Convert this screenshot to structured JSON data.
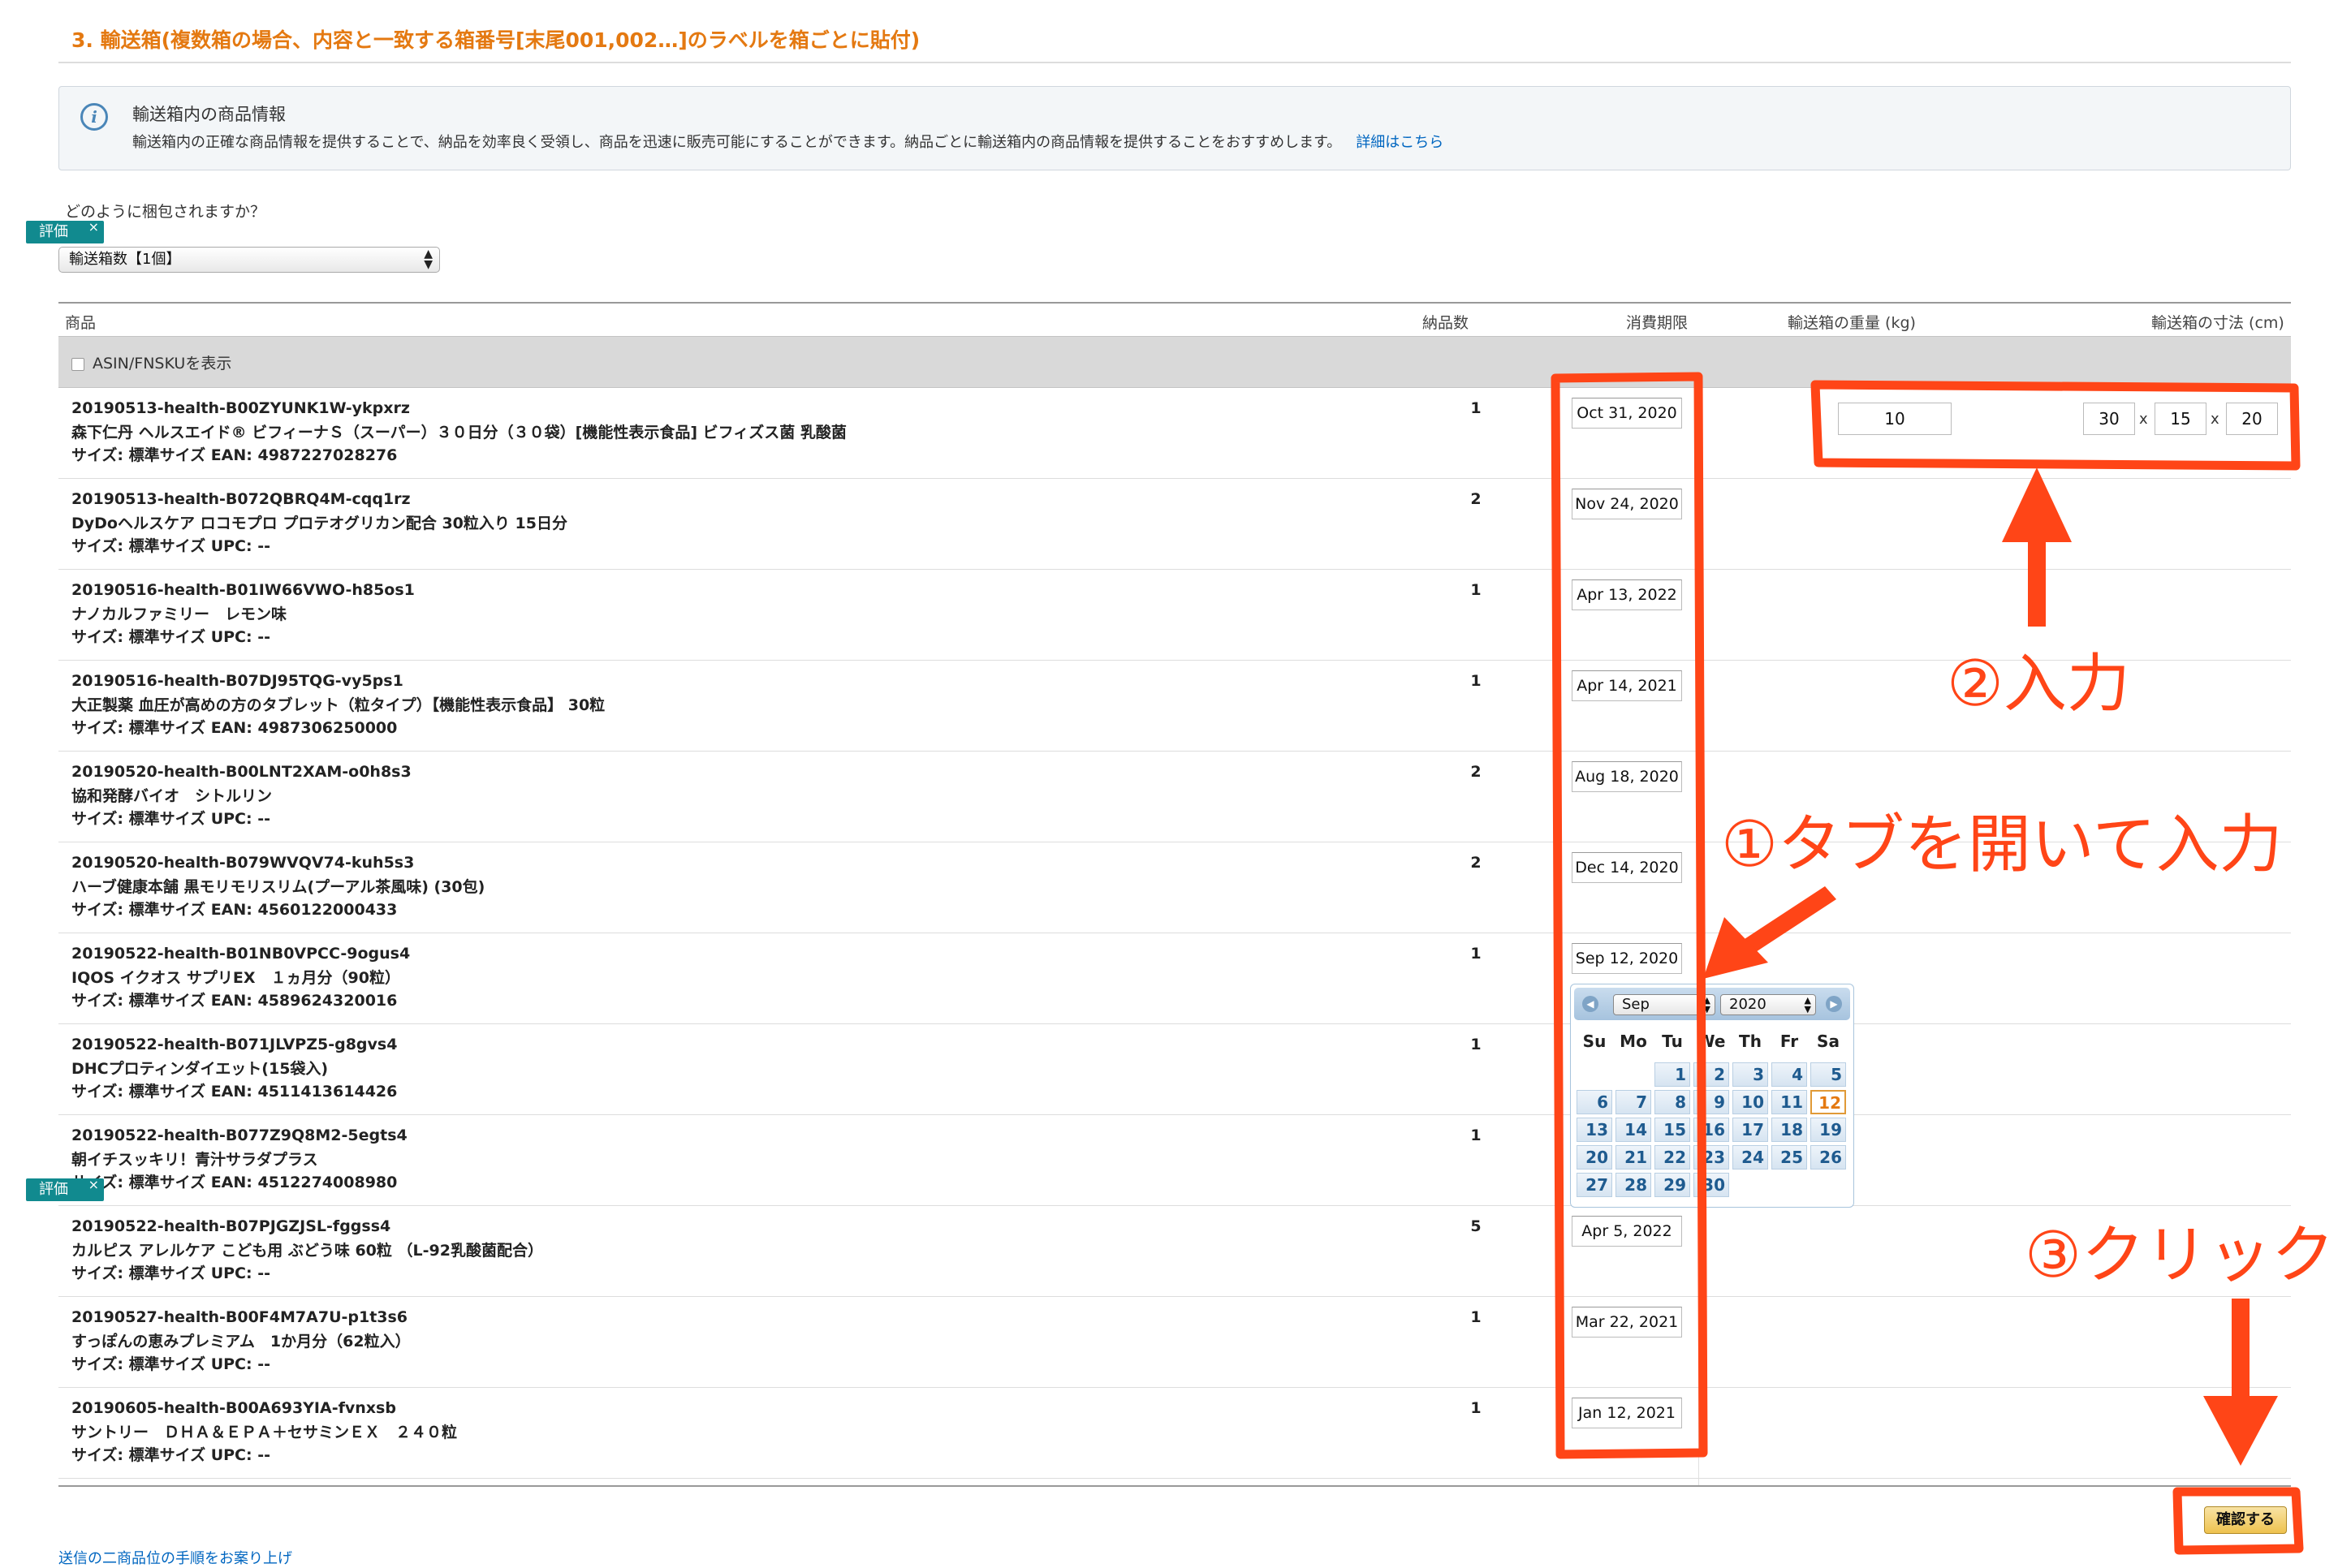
{
  "section": {
    "title": "3. 輸送箱(複数箱の場合、内容と一致する箱番号[末尾001,002…]のラベルを箱ごとに貼付)"
  },
  "info": {
    "icon": "info-icon",
    "title": "輸送箱内の商品情報",
    "body": "輸送箱内の正確な商品情報を提供することで、納品を効率良く受領し、商品を迅速に販売可能にすることができます。納品ごとに輸送箱内の商品情報を提供することをおすすめします。",
    "link": "詳細はこちら"
  },
  "packing": {
    "question": "どのように梱包されますか？",
    "eval_tag": "評価",
    "eval_close": "×",
    "selected": "輸送箱数【1個】"
  },
  "table": {
    "headers": {
      "product": "商品",
      "qty": "納品数",
      "expiry": "消費期限",
      "weight": "輸送箱の重量 (kg)",
      "dims": "輸送箱の寸法 (cm)"
    },
    "asin_label": "ASIN/FNSKUを表示",
    "rows": [
      {
        "sku": "20190513-health-B00ZYUNK1W-ykpxrz",
        "name": "森下仁丹 ヘルスエイド® ビフィーナＳ（スーパー）３０日分（３０袋）[機能性表示食品] ビフィズス菌 乳酸菌",
        "meta": "サイズ: 標準サイズ EAN: 4987227028276",
        "qty": "1",
        "date": "Oct 31, 2020"
      },
      {
        "sku": "20190513-health-B072QBRQ4M-cqq1rz",
        "name": "DyDoヘルスケア ロコモプロ プロテオグリカン配合 30粒入り 15日分",
        "meta": "サイズ: 標準サイズ UPC: --",
        "qty": "2",
        "date": "Nov 24, 2020"
      },
      {
        "sku": "20190516-health-B01IW66VWO-h85os1",
        "name": "ナノカルファミリー　レモン味",
        "meta": "サイズ: 標準サイズ UPC: --",
        "qty": "1",
        "date": "Apr 13, 2022"
      },
      {
        "sku": "20190516-health-B07DJ95TQG-vy5ps1",
        "name": "大正製薬 血圧が高めの方のタブレット（粒タイプ）【機能性表示食品】 30粒",
        "meta": "サイズ: 標準サイズ EAN: 4987306250000",
        "qty": "1",
        "date": "Apr 14, 2021"
      },
      {
        "sku": "20190520-health-B00LNT2XAM-o0h8s3",
        "name": "協和発酵バイオ　シトルリン",
        "meta": "サイズ: 標準サイズ UPC: --",
        "qty": "2",
        "date": "Aug 18, 2020"
      },
      {
        "sku": "20190520-health-B079WVQV74-kuh5s3",
        "name": "ハーブ健康本舗 黒モリモリスリム(プーアル茶風味) (30包)",
        "meta": "サイズ: 標準サイズ EAN: 4560122000433",
        "qty": "2",
        "date": "Dec 14, 2020"
      },
      {
        "sku": "20190522-health-B01NB0VPCC-9ogus4",
        "name": "IQOS イクオス サプリEX　１ヵ月分（90粒）",
        "meta": "サイズ: 標準サイズ EAN: 4589624320016",
        "qty": "1",
        "date": "Sep 12, 2020"
      },
      {
        "sku": "20190522-health-B071JLVPZ5-g8gvs4",
        "name": "DHCプロティンダイエット(15袋入)",
        "meta": "サイズ: 標準サイズ EAN: 4511413614426",
        "qty": "1",
        "date": ""
      },
      {
        "sku": "20190522-health-B077Z9Q8M2-5egts4",
        "name": "朝イチスッキリ！青汁サラダプラス",
        "meta": "サイズ: 標準サイズ EAN: 4512274008980",
        "qty": "1",
        "date": ""
      },
      {
        "sku": "20190522-health-B07PJGZJSL-fggss4",
        "name": "カルピス アレルケア こども用 ぶどう味 60粒 （L-92乳酸菌配合）",
        "meta": "サイズ: 標準サイズ UPC: --",
        "qty": "5",
        "date": "Apr 5, 2022"
      },
      {
        "sku": "20190527-health-B00F4M7A7U-p1t3s6",
        "name": "すっぽんの恵みプレミアム　1か月分（62粒入）",
        "meta": "サイズ: 標準サイズ UPC: --",
        "qty": "1",
        "date": "Mar 22, 2021"
      },
      {
        "sku": "20190605-health-B00A693YIA-fvnxsb",
        "name": "サントリー　ＤＨＡ＆ＥＰＡ＋セサミンＥＸ　２４０粒",
        "meta": "サイズ: 標準サイズ UPC: --",
        "qty": "1",
        "date": "Jan 12, 2021"
      }
    ],
    "weight": "10",
    "dim_length": "30",
    "dim_width": "15",
    "dim_height": "20",
    "dim_sep": "x"
  },
  "calendar": {
    "prev_icon": "chevron-left-icon",
    "next_icon": "chevron-right-icon",
    "prev": "◀",
    "next": "▶",
    "month": "Sep",
    "year": "2020",
    "dow": [
      "Su",
      "Mo",
      "Tu",
      "We",
      "Th",
      "Fr",
      "Sa"
    ],
    "first_weekday": 2,
    "days_in_month": 30,
    "selected_day": 12
  },
  "footer": {
    "confirm": "確認する",
    "link": "送信の二商品位の手順をお案り上げ"
  },
  "annotations": {
    "color": "#ff4517",
    "step1": "①タブを開いて入力",
    "step2": "②入力",
    "step3": "③クリック"
  }
}
